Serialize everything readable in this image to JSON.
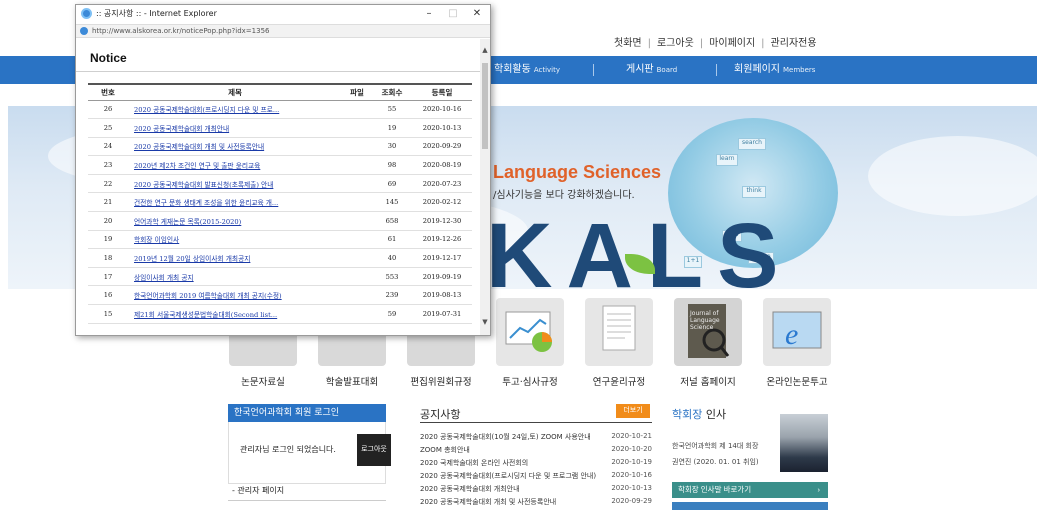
{
  "top_links": [
    "첫화면",
    "로그아웃",
    "마이페이지",
    "관리자전용"
  ],
  "nav": [
    {
      "label": "학회활동",
      "sub": "Activity"
    },
    {
      "label": "게시판",
      "sub": "Board"
    },
    {
      "label": "회원페이지",
      "sub": "Members"
    }
  ],
  "banner": {
    "title": "Language Sciences",
    "subtitle": "/심사기능을 보다 강화하겠습니다.",
    "logo": "KALS",
    "diagram_words": [
      "search",
      "learn",
      "think",
      "idea",
      "create",
      "1+1"
    ]
  },
  "quick_icons": [
    "논문자료실",
    "학술발표대회",
    "편집위원회규정",
    "투고·심사규정",
    "연구윤리규정",
    "저널 홈페이지",
    "온라인논문투고"
  ],
  "journal_cover_text": "Journal of Language Science",
  "login": {
    "heading": "한국언어과학회 회원 로그인",
    "message": "관리자님 로그인 되었습니다.",
    "logout_button": "로그아웃",
    "admin_link": "- 관리자 페이지"
  },
  "notice_box": {
    "heading": "공지사항",
    "more_button": "더보기",
    "items": [
      {
        "title": "2020 공동국제학술대회(10월 24일,토) ZOOM 사용안내",
        "date": "2020-10-21"
      },
      {
        "title": "ZOOM 총회안내",
        "date": "2020-10-20"
      },
      {
        "title": "2020 국제학술대회 온라인 사전회의",
        "date": "2020-10-19"
      },
      {
        "title": "2020 공동국제학술대회(프로시딩지 다운 및 프로그램 안내)",
        "date": "2020-10-16"
      },
      {
        "title": "2020 공동국제학술대회 개최안내",
        "date": "2020-10-13"
      },
      {
        "title": "2020 공동국제학술대회 개최 및 사전등록안내",
        "date": "2020-09-29"
      }
    ]
  },
  "president": {
    "heading_blue": "학회장",
    "heading_rest": " 인사",
    "line1": "한국언어과학회 제 14대 회장",
    "line2": "권연진 (2020. 01. 01 취임)",
    "button": "학회장 인사말 바로가기",
    "button_arrow": "›"
  },
  "popup": {
    "window_title": ":: 공지사항 :: - Internet Explorer",
    "url": "http://www.alskorea.or.kr/noticePop.php?idx=1356",
    "controls": [
      "–",
      "□",
      "✕"
    ],
    "heading": "Notice",
    "columns": [
      "번호",
      "제목",
      "파일",
      "조회수",
      "등록일"
    ],
    "rows": [
      {
        "no": "26",
        "title": "2020 공동국제학술대회(프로시딩지 다운 및 프로...",
        "file": "",
        "views": "55",
        "date": "2020-10-16"
      },
      {
        "no": "25",
        "title": "2020 공동국제학술대회 개최안내",
        "file": "",
        "views": "19",
        "date": "2020-10-13"
      },
      {
        "no": "24",
        "title": "2020 공동국제학술대회 개최 및 사전등록안내",
        "file": "",
        "views": "30",
        "date": "2020-09-29"
      },
      {
        "no": "23",
        "title": "2020년 제2차 조건인 연구 및 출판 윤리교육",
        "file": "",
        "views": "98",
        "date": "2020-08-19"
      },
      {
        "no": "22",
        "title": "2020 공동국제학술대회 발표신청(초록제출) 안내",
        "file": "",
        "views": "69",
        "date": "2020-07-23"
      },
      {
        "no": "21",
        "title": "건전한 연구 문화 생태계 조성을 위한 윤리교육 개...",
        "file": "",
        "views": "145",
        "date": "2020-02-12"
      },
      {
        "no": "20",
        "title": "언어과학 게재논문 목록(2015-2020)",
        "file": "",
        "views": "658",
        "date": "2019-12-30"
      },
      {
        "no": "19",
        "title": "학회장 이임인사",
        "file": "",
        "views": "61",
        "date": "2019-12-26"
      },
      {
        "no": "18",
        "title": "2019년 12월 20일 상임이사회 개최공지",
        "file": "",
        "views": "40",
        "date": "2019-12-17"
      },
      {
        "no": "17",
        "title": "상임이사회 개최 공지",
        "file": "",
        "views": "553",
        "date": "2019-09-19"
      },
      {
        "no": "16",
        "title": "한국언어과학회 2019 여름학술대회 개최 공지(수정)",
        "file": "",
        "views": "239",
        "date": "2019-08-13"
      },
      {
        "no": "15",
        "title": "제21회 서울국제생성문법학술대회(Second list...",
        "file": "",
        "views": "59",
        "date": "2019-07-31"
      }
    ]
  }
}
